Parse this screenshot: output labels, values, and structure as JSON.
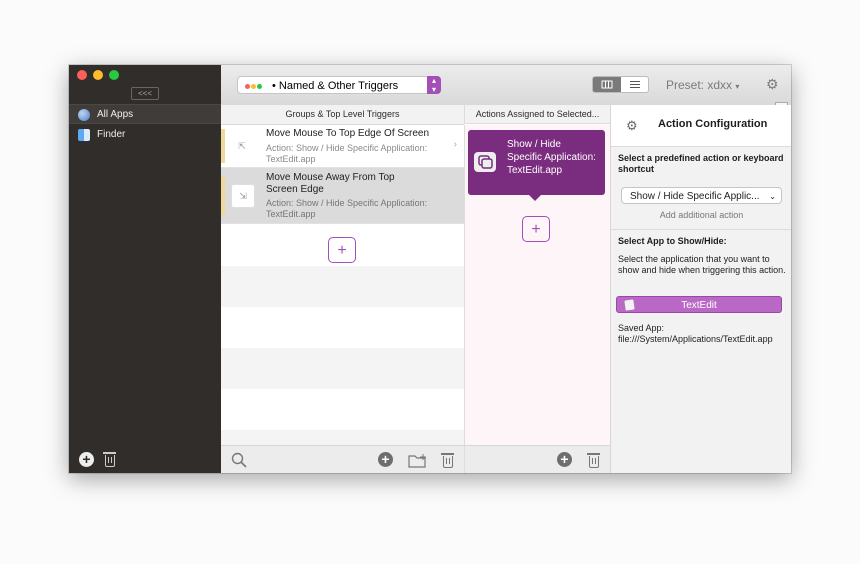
{
  "sidebar": {
    "collapse_label": "<<<",
    "items": [
      {
        "label": "All Apps",
        "icon": "globe-icon",
        "selected": true
      },
      {
        "label": "Finder",
        "icon": "finder-icon",
        "selected": false
      }
    ]
  },
  "toolbar": {
    "group_dropdown": "• Named & Other Triggers",
    "preset_label": "Preset: xdxx",
    "preset_caret": "▾"
  },
  "triggers_column": {
    "header": "Groups & Top Level Triggers",
    "items": [
      {
        "title": "Move Mouse To Top Edge Of Screen",
        "subtitle": "Action: Show / Hide Specific Application: TextEdit.app"
      },
      {
        "title": "Move Mouse Away From Top Screen Edge",
        "subtitle": "Action: Show / Hide Specific Application: TextEdit.app"
      }
    ],
    "add_label": "+"
  },
  "actions_column": {
    "header": "Actions Assigned to Selected...",
    "action_label": "Show / Hide Specific Application: TextEdit.app",
    "add_label": "+"
  },
  "config_panel": {
    "title": "Action Configuration",
    "predefined_label": "Select a predefined action or keyboard shortcut",
    "selected_action": "Show / Hide Specific Applic...",
    "add_additional": "Add additional action",
    "app_section_title": "Select App to Show/Hide:",
    "app_description": "Select the application that you want to show and hide when triggering this action.",
    "app_button": "TextEdit",
    "saved_app": "Saved App: file:///System/Applications/TextEdit.app"
  },
  "colors": {
    "accent": "#a44eb7",
    "action_bg": "#7a2d7f",
    "sidebar_bg": "#302d2b",
    "trigger_bar": "#eed89a"
  }
}
